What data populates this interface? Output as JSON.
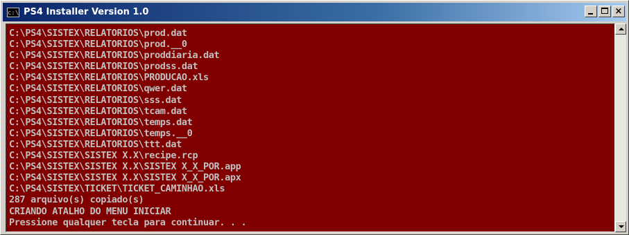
{
  "window": {
    "title": "PS4 Installer Version 1.0",
    "icon": "console-icon",
    "icon_text": "c:\\",
    "controls": [
      "minimize-icon",
      "maximize-icon",
      "close-icon"
    ]
  },
  "colors": {
    "console_background": "#800000",
    "console_text": "#c0c0c0",
    "titlebar_start": "#0a246a",
    "titlebar_end": "#a6caf0"
  },
  "console": {
    "lines": [
      "C:\\PS4\\SISTEX\\RELATORIOS\\prod.dat",
      "C:\\PS4\\SISTEX\\RELATORIOS\\prod.__0",
      "C:\\PS4\\SISTEX\\RELATORIOS\\proddiaria.dat",
      "C:\\PS4\\SISTEX\\RELATORIOS\\prodss.dat",
      "C:\\PS4\\SISTEX\\RELATORIOS\\PRODUCAO.xls",
      "C:\\PS4\\SISTEX\\RELATORIOS\\qwer.dat",
      "C:\\PS4\\SISTEX\\RELATORIOS\\sss.dat",
      "C:\\PS4\\SISTEX\\RELATORIOS\\tcam.dat",
      "C:\\PS4\\SISTEX\\RELATORIOS\\temps.dat",
      "C:\\PS4\\SISTEX\\RELATORIOS\\temps.__0",
      "C:\\PS4\\SISTEX\\RELATORIOS\\ttt.dat",
      "C:\\PS4\\SISTEX\\SISTEX X.X\\recipe.rcp",
      "C:\\PS4\\SISTEX\\SISTEX X.X\\SISTEX X_X_POR.app",
      "C:\\PS4\\SISTEX\\SISTEX X.X\\SISTEX X_X_POR.apx",
      "C:\\PS4\\SISTEX\\TICKET\\TICKET_CAMINHAO.xls",
      "287 arquivo(s) copiado(s)",
      "CRIANDO ATALHO DO MENU INICIAR",
      "Pressione qualquer tecla para continuar. . ."
    ]
  }
}
